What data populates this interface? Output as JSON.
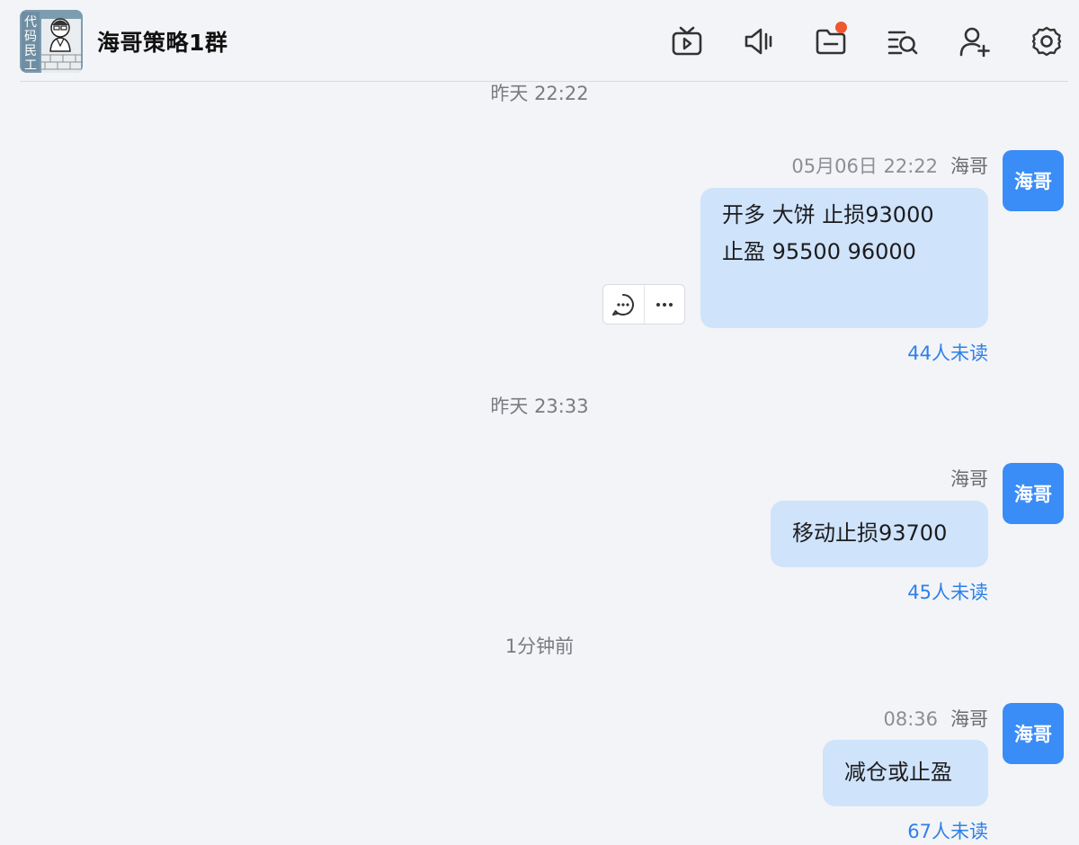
{
  "header": {
    "group_name": "海哥策略1群",
    "avatar_badge_text": "代码民工",
    "toolbar": [
      {
        "name": "live-tv-icon"
      },
      {
        "name": "announcement-icon"
      },
      {
        "name": "folder-icon",
        "has_notification": true
      },
      {
        "name": "search-history-icon"
      },
      {
        "name": "add-member-icon"
      },
      {
        "name": "settings-gear-icon"
      }
    ]
  },
  "colors": {
    "background": "#f3f4f7",
    "bubble": "#cfe3fb",
    "avatar": "#3a8cf7",
    "unread_link": "#2f80e8",
    "notification_dot": "#f0562f"
  },
  "messages": [
    {
      "time_separator": "昨天 22:22",
      "timestamp": "05月06日 22:22",
      "sender": "海哥",
      "avatar_text": "海哥",
      "lines": [
        "开多 大饼 止损93000",
        "",
        "止盈 95500 96000"
      ],
      "unread": "44人未读"
    },
    {
      "time_separator": "昨天 23:33",
      "timestamp": "",
      "sender": "海哥",
      "avatar_text": "海哥",
      "lines": [
        "移动止损93700"
      ],
      "unread": "45人未读"
    },
    {
      "time_separator": "1分钟前",
      "timestamp": "08:36",
      "sender": "海哥",
      "avatar_text": "海哥",
      "lines": [
        "减仓或止盈"
      ],
      "unread": "67人未读"
    }
  ]
}
